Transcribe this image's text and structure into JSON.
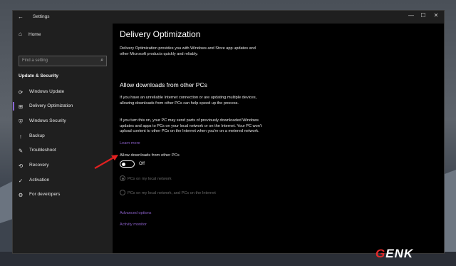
{
  "window": {
    "title": "Settings",
    "controls": [
      "—",
      "☐",
      "✕"
    ]
  },
  "sidebar": {
    "home_label": "Home",
    "search_placeholder": "Find a setting",
    "section_title": "Update & Security",
    "items": [
      {
        "label": "Windows Update",
        "icon": "sync-icon"
      },
      {
        "label": "Delivery Optimization",
        "icon": "delivery-icon",
        "active": true
      },
      {
        "label": "Windows Security",
        "icon": "shield-icon"
      },
      {
        "label": "Backup",
        "icon": "backup-icon"
      },
      {
        "label": "Troubleshoot",
        "icon": "wrench-icon"
      },
      {
        "label": "Recovery",
        "icon": "recovery-icon"
      },
      {
        "label": "Activation",
        "icon": "check-circle-icon"
      },
      {
        "label": "For developers",
        "icon": "developer-icon"
      }
    ]
  },
  "content": {
    "title": "Delivery Optimization",
    "intro": "Delivery Optimization provides you with Windows and Store app updates and other Microsoft products quickly and reliably.",
    "section_heading": "Allow downloads from other PCs",
    "para1": "If you have an unreliable Internet connection or are updating multiple devices, allowing downloads from other PCs can help speed up the process.",
    "para2": "If you turn this on, your PC may send parts of previously downloaded Windows updates and apps to PCs on your local network or on the Internet. Your PC won't upload content to other PCs on the Internet when you're on a metered network.",
    "learn_more": "Learn more",
    "toggle_label": "Allow downloads from other PCs",
    "toggle_state": "Off",
    "radio1": "PCs on my local network",
    "radio2": "PCs on my local network, and PCs on the Internet",
    "advanced_options": "Advanced options",
    "activity_monitor": "Activity monitor"
  },
  "watermark": {
    "prefix": "G",
    "rest": "ENK"
  },
  "colors": {
    "accent": "#8a5fc8",
    "arrow": "#e02020"
  }
}
